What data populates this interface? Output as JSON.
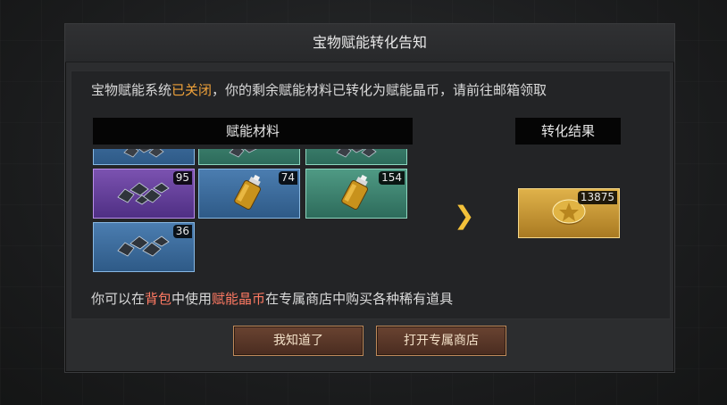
{
  "dialog": {
    "title": "宝物赋能转化告知",
    "notice": {
      "part1": "宝物赋能系统",
      "highlight": "已关闭",
      "part2": "，你的剩余赋能材料已转化为赋能晶币，请前往邮箱领取"
    },
    "materials_header": "赋能材料",
    "result_header": "转化结果",
    "materials": [
      {
        "rarity": "blue",
        "icon": "ore-icon",
        "count": ""
      },
      {
        "rarity": "green",
        "icon": "ore-icon",
        "count": ""
      },
      {
        "rarity": "green",
        "icon": "ore-icon",
        "count": ""
      },
      {
        "rarity": "purple",
        "icon": "ore-icon",
        "count": "95"
      },
      {
        "rarity": "blue",
        "icon": "oil-bottle-icon",
        "count": "74"
      },
      {
        "rarity": "green",
        "icon": "oil-bottle-icon",
        "count": "154"
      },
      {
        "rarity": "blue",
        "icon": "ore-icon",
        "count": "36"
      }
    ],
    "result": {
      "rarity": "gold",
      "icon": "coin-icon",
      "count": "13875"
    },
    "tip": {
      "part1": "你可以在",
      "bag": "背包",
      "part2": "中使用",
      "coin": "赋能晶币",
      "part3": "在专属商店中购买各种稀有道具"
    },
    "buttons": {
      "ok": "我知道了",
      "shop": "打开专属商店"
    }
  }
}
